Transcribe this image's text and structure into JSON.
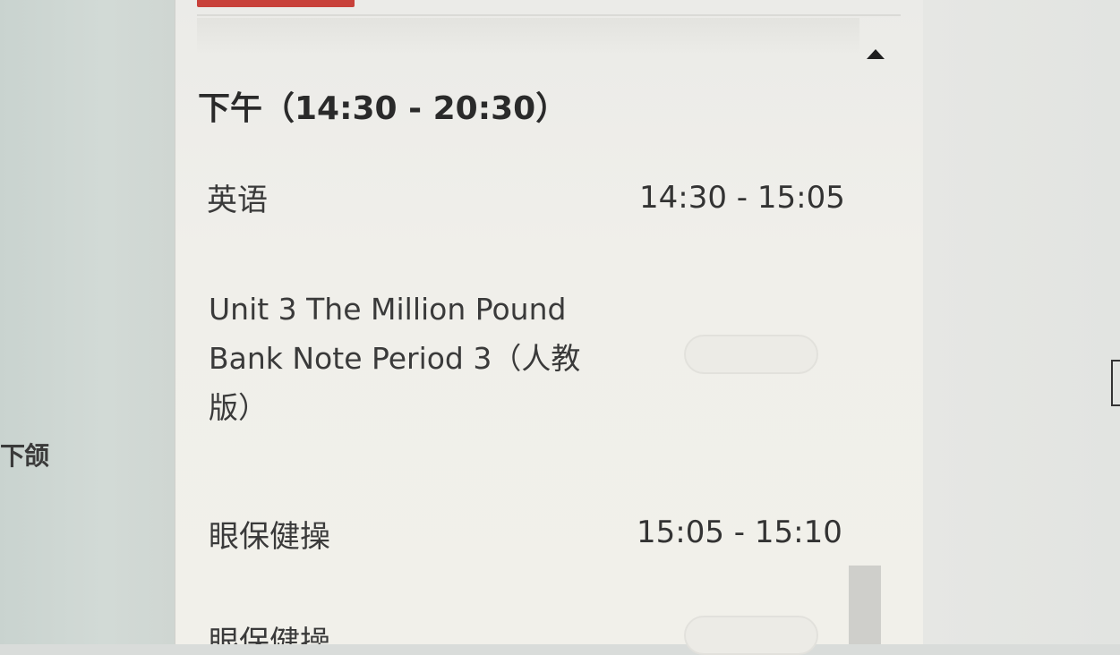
{
  "sidebar": {
    "partial_label": "下颌"
  },
  "schedule": {
    "section_title": "下午（14:30 - 20:30）",
    "entries": [
      {
        "subject": "英语",
        "time": "14:30 - 15:05",
        "lesson_lines": [
          "Unit 3 The Million Pound",
          "Bank Note Period 3（人教",
          "版）"
        ]
      },
      {
        "subject": "眼保健操",
        "time": "15:05 - 15:10"
      },
      {
        "subject": "眼保健操"
      }
    ]
  },
  "colors": {
    "tab_accent": "#c8413a",
    "panel_background": "#f0efea",
    "left_background": "#cfd6d2"
  },
  "icons": {
    "scroll_up": "triangle-up-icon",
    "side_handle": "bracket-icon"
  }
}
